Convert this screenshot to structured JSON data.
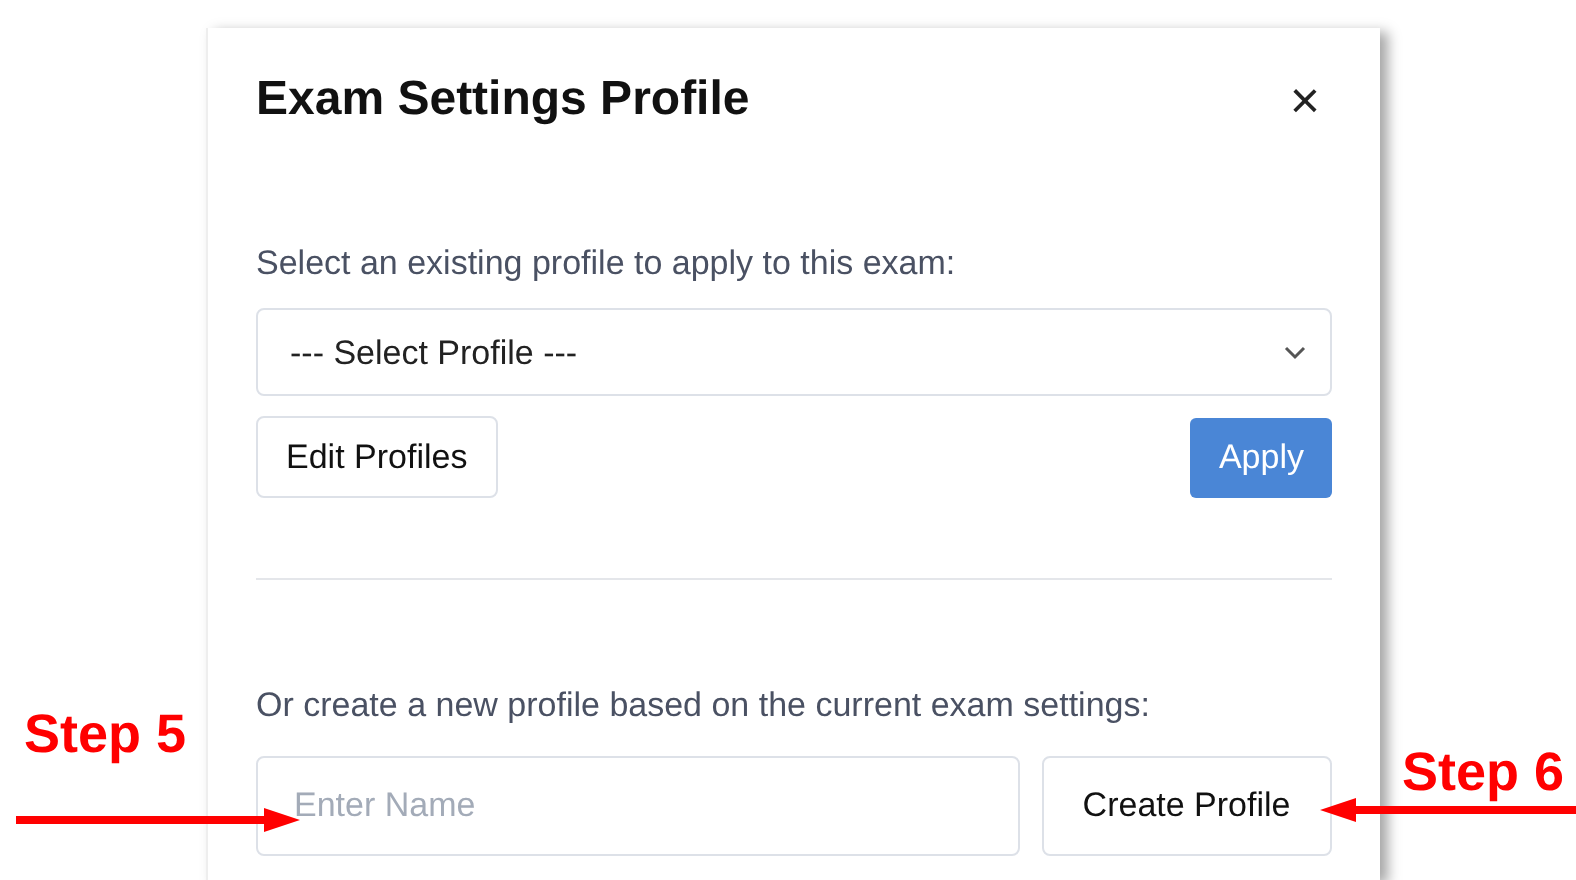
{
  "dialog": {
    "title": "Exam Settings Profile",
    "close": "×"
  },
  "existing": {
    "label": "Select an existing profile to apply to this exam:",
    "select_value": "--- Select Profile ---",
    "edit_button": "Edit Profiles",
    "apply_button": "Apply"
  },
  "create": {
    "label": "Or create a new profile based on the current exam settings:",
    "placeholder": "Enter Name",
    "create_button": "Create Profile"
  },
  "annotations": [
    {
      "text": "Step 5",
      "kind": "left"
    },
    {
      "text": "Step 6",
      "kind": "right"
    }
  ]
}
